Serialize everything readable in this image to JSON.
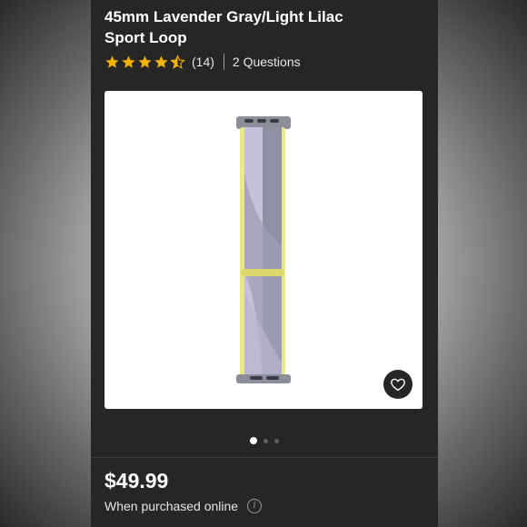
{
  "product": {
    "title_line1": "45mm Lavender Gray/Light Lilac",
    "title_line2": "Sport Loop",
    "rating_value": 4.5,
    "rating_count_label": "(14)",
    "questions_label": "2 Questions",
    "price": "$49.99",
    "purchase_note": "When purchased online",
    "info_glyph": "i"
  },
  "carousel": {
    "image_count": 3,
    "active_index": 0
  },
  "icons": {
    "star": "star-icon",
    "heart": "heart-icon",
    "info": "info-icon"
  },
  "colors": {
    "panel_bg": "#262626",
    "star": "#f5b301",
    "band_lavender": "#b7b3d0",
    "band_gray": "#8f8fa6",
    "band_yellow": "#e9e98a"
  }
}
